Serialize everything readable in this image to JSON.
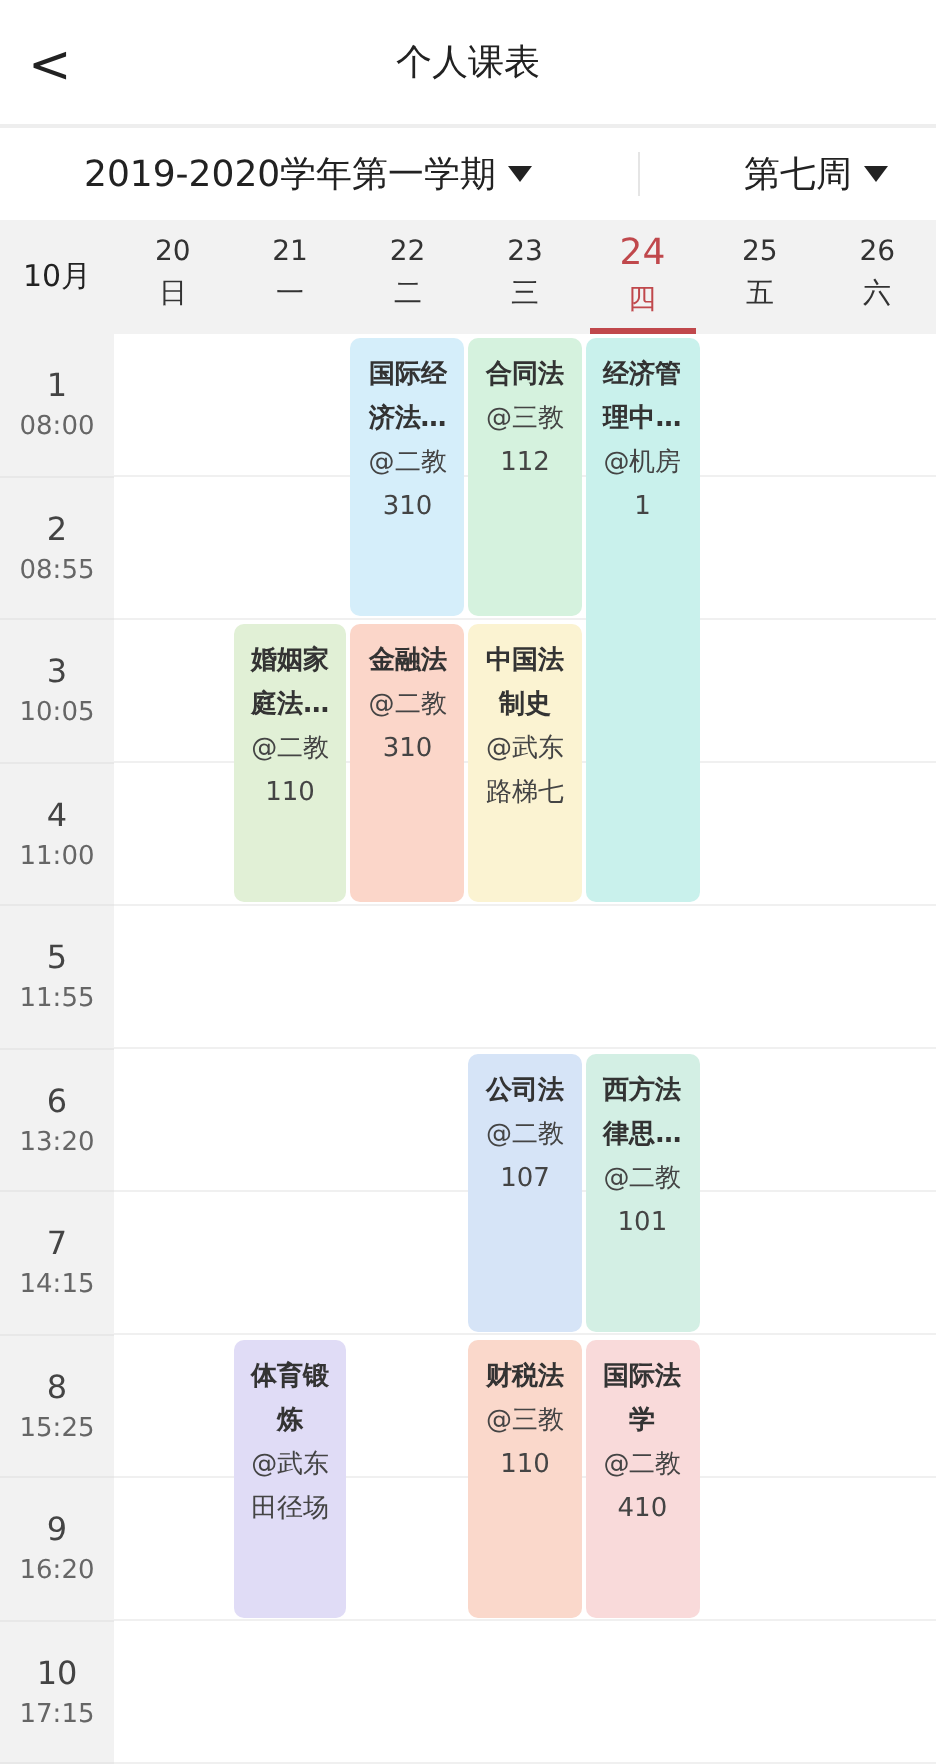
{
  "header": {
    "back": "<",
    "title": "个人课表"
  },
  "selectors": [
    {
      "label": "2019-2020学年第一学期"
    },
    {
      "label": "第七周"
    }
  ],
  "month": "10月",
  "days": [
    {
      "date": "20",
      "weekday": "日",
      "selected": false
    },
    {
      "date": "21",
      "weekday": "一",
      "selected": false
    },
    {
      "date": "22",
      "weekday": "二",
      "selected": false
    },
    {
      "date": "23",
      "weekday": "三",
      "selected": false
    },
    {
      "date": "24",
      "weekday": "四",
      "selected": true
    },
    {
      "date": "25",
      "weekday": "五",
      "selected": false
    },
    {
      "date": "26",
      "weekday": "六",
      "selected": false
    }
  ],
  "periods": [
    {
      "number": "1",
      "time": "08:00"
    },
    {
      "number": "2",
      "time": "08:55"
    },
    {
      "number": "3",
      "time": "10:05"
    },
    {
      "number": "4",
      "time": "11:00"
    },
    {
      "number": "5",
      "time": "11:55"
    },
    {
      "number": "6",
      "time": "13:20"
    },
    {
      "number": "7",
      "time": "14:15"
    },
    {
      "number": "8",
      "time": "15:25"
    },
    {
      "number": "9",
      "time": "16:20"
    },
    {
      "number": "10",
      "time": "17:15"
    }
  ],
  "courses": [
    {
      "title": "国际经济法…",
      "location": "@二教310",
      "color": "#d5eefa"
    },
    {
      "title": "合同法",
      "location": "@三教112",
      "color": "#d5f2de"
    },
    {
      "title": "经济管理中…",
      "location": "@机房1",
      "color": "#c9f1ec"
    },
    {
      "title": "婚姻家庭法…",
      "location": "@二教110",
      "color": "#e1f0d6"
    },
    {
      "title": "金融法",
      "location": "@二教310",
      "color": "#fbd6c9"
    },
    {
      "title": "中国法制史",
      "location": "@武东路梯七",
      "color": "#fbf3d2"
    },
    {
      "title": "公司法",
      "location": "@二教107",
      "color": "#d6e4f7"
    },
    {
      "title": "西方法律思…",
      "location": "@二教101",
      "color": "#d3efe4"
    },
    {
      "title": "体育锻炼",
      "location": "@武东田径场",
      "color": "#e0dcf6"
    },
    {
      "title": "财税法",
      "location": "@三教110",
      "color": "#fad8cb"
    },
    {
      "title": "国际法学",
      "location": "@二教410",
      "color": "#f9dada"
    }
  ]
}
